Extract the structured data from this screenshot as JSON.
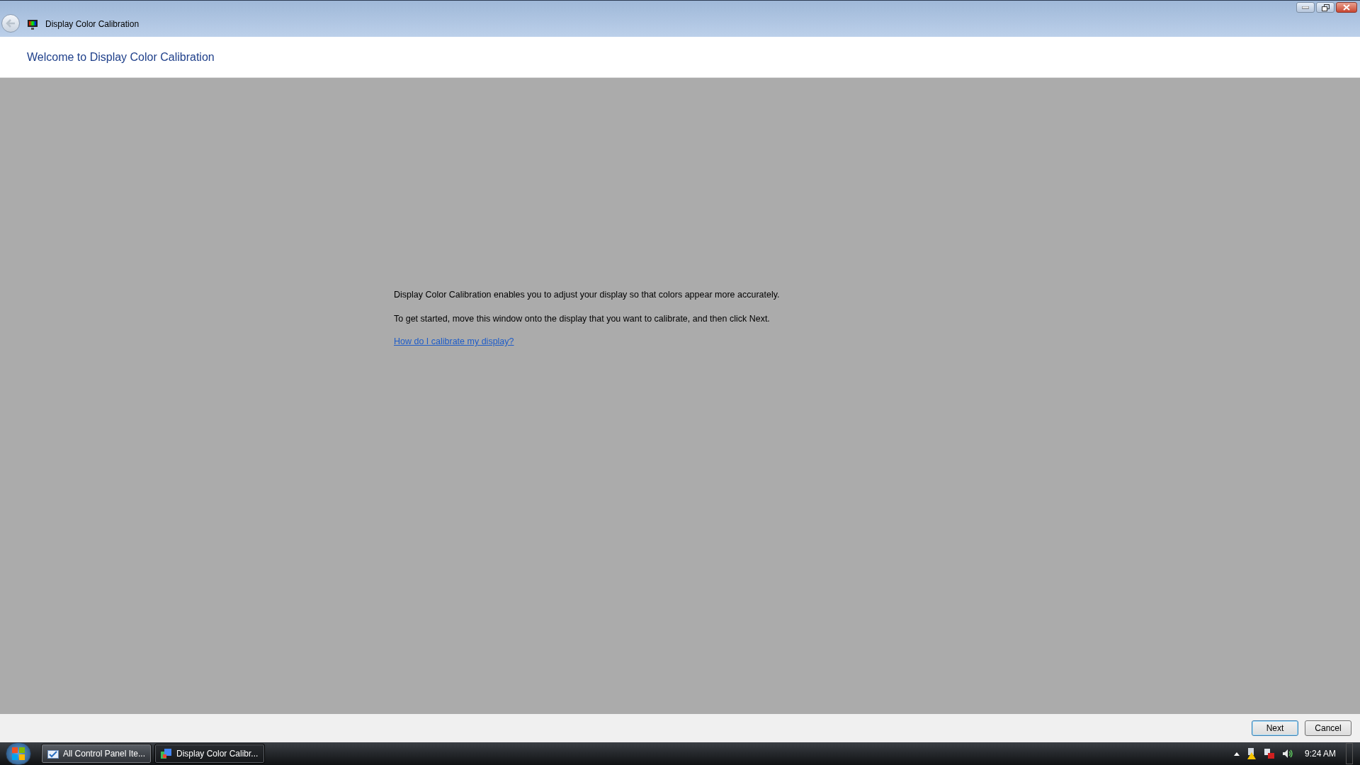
{
  "window": {
    "title": "Display Color Calibration"
  },
  "header": {
    "title": "Welcome to Display Color Calibration"
  },
  "body": {
    "paragraphs": [
      "Display Color Calibration enables you to adjust your display so that colors appear more accurately.",
      "To get started, move this window onto the display that you want to calibrate, and then click Next."
    ],
    "link": "How do I calibrate my display?"
  },
  "buttons": [
    {
      "label": "Next",
      "focused": true
    },
    {
      "label": "Cancel",
      "focused": false
    }
  ],
  "taskbar": {
    "items": [
      {
        "label": "All Control Panel Ite...",
        "kind": "control-panel",
        "selected": false
      },
      {
        "label": "Display Color Calibr...",
        "kind": "calibration",
        "selected": true
      }
    ],
    "clock": "9:24 AM"
  }
}
